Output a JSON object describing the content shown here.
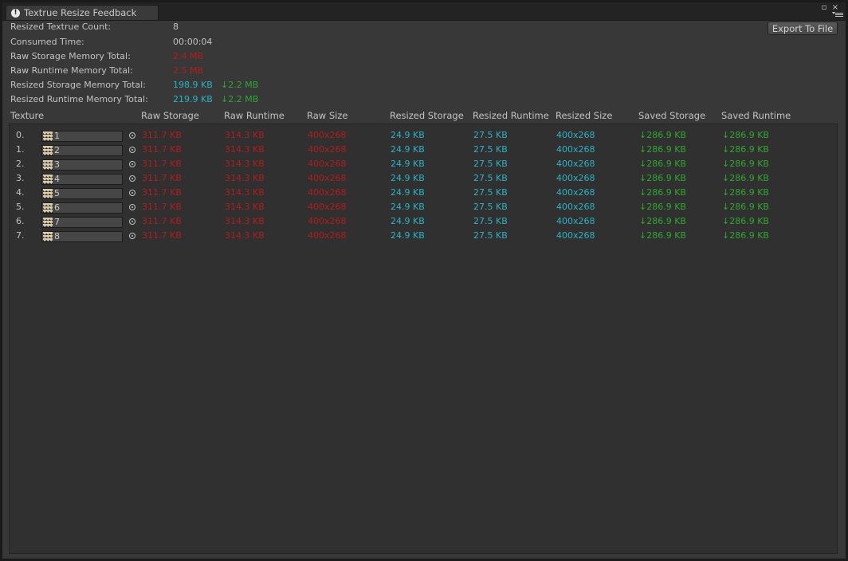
{
  "window": {
    "tab_title": "Textrue Resize Feedback",
    "tab_icon": "warning-icon"
  },
  "summary": {
    "count_label": "Resized Textrue Count:",
    "count_value": "8",
    "time_label": "Consumed Time:",
    "time_value": "00:00:04",
    "raw_storage_label": "Raw Storage Memory Total:",
    "raw_storage_value": "2.4 MB",
    "raw_runtime_label": "Raw Runtime Memory Total:",
    "raw_runtime_value": "2.5 MB",
    "resized_storage_label": "Resized Storage Memory Total:",
    "resized_storage_value": "198.9 KB",
    "resized_storage_saved": "↓2.2 MB",
    "resized_runtime_label": "Resized Runtime Memory Total:",
    "resized_runtime_value": "219.9 KB",
    "resized_runtime_saved": "↓2.2 MB"
  },
  "toolbar": {
    "export_label": "Export To File"
  },
  "columns": [
    "Texture",
    "Raw Storage",
    "Raw Runtime",
    "Raw Size",
    "Resized Storage",
    "Resized Runtime",
    "Resized Size",
    "Saved Storage",
    "Saved Runtime"
  ],
  "rows": [
    {
      "index": "0.",
      "name": "1",
      "raw_storage": "311.7 KB",
      "raw_runtime": "314.3 KB",
      "raw_size": "400x268",
      "resized_storage": "24.9 KB",
      "resized_runtime": "27.5 KB",
      "resized_size": "400x268",
      "saved_storage": "↓286.9 KB",
      "saved_runtime": "↓286.9 KB"
    },
    {
      "index": "1.",
      "name": "2",
      "raw_storage": "311.7 KB",
      "raw_runtime": "314.3 KB",
      "raw_size": "400x268",
      "resized_storage": "24.9 KB",
      "resized_runtime": "27.5 KB",
      "resized_size": "400x268",
      "saved_storage": "↓286.9 KB",
      "saved_runtime": "↓286.9 KB"
    },
    {
      "index": "2.",
      "name": "3",
      "raw_storage": "311.7 KB",
      "raw_runtime": "314.3 KB",
      "raw_size": "400x268",
      "resized_storage": "24.9 KB",
      "resized_runtime": "27.5 KB",
      "resized_size": "400x268",
      "saved_storage": "↓286.9 KB",
      "saved_runtime": "↓286.9 KB"
    },
    {
      "index": "3.",
      "name": "4",
      "raw_storage": "311.7 KB",
      "raw_runtime": "314.3 KB",
      "raw_size": "400x268",
      "resized_storage": "24.9 KB",
      "resized_runtime": "27.5 KB",
      "resized_size": "400x268",
      "saved_storage": "↓286.9 KB",
      "saved_runtime": "↓286.9 KB"
    },
    {
      "index": "4.",
      "name": "5",
      "raw_storage": "311.7 KB",
      "raw_runtime": "314.3 KB",
      "raw_size": "400x268",
      "resized_storage": "24.9 KB",
      "resized_runtime": "27.5 KB",
      "resized_size": "400x268",
      "saved_storage": "↓286.9 KB",
      "saved_runtime": "↓286.9 KB"
    },
    {
      "index": "5.",
      "name": "6",
      "raw_storage": "311.7 KB",
      "raw_runtime": "314.3 KB",
      "raw_size": "400x268",
      "resized_storage": "24.9 KB",
      "resized_runtime": "27.5 KB",
      "resized_size": "400x268",
      "saved_storage": "↓286.9 KB",
      "saved_runtime": "↓286.9 KB"
    },
    {
      "index": "6.",
      "name": "7",
      "raw_storage": "311.7 KB",
      "raw_runtime": "314.3 KB",
      "raw_size": "400x268",
      "resized_storage": "24.9 KB",
      "resized_runtime": "27.5 KB",
      "resized_size": "400x268",
      "saved_storage": "↓286.9 KB",
      "saved_runtime": "↓286.9 KB"
    },
    {
      "index": "7.",
      "name": "8",
      "raw_storage": "311.7 KB",
      "raw_runtime": "314.3 KB",
      "raw_size": "400x268",
      "resized_storage": "24.9 KB",
      "resized_runtime": "27.5 KB",
      "resized_size": "400x268",
      "saved_storage": "↓286.9 KB",
      "saved_runtime": "↓286.9 KB"
    }
  ],
  "colors": {
    "raw": "#b31c1c",
    "resized": "#2bb3c4",
    "saved": "#2ea82e",
    "background": "#383838"
  }
}
